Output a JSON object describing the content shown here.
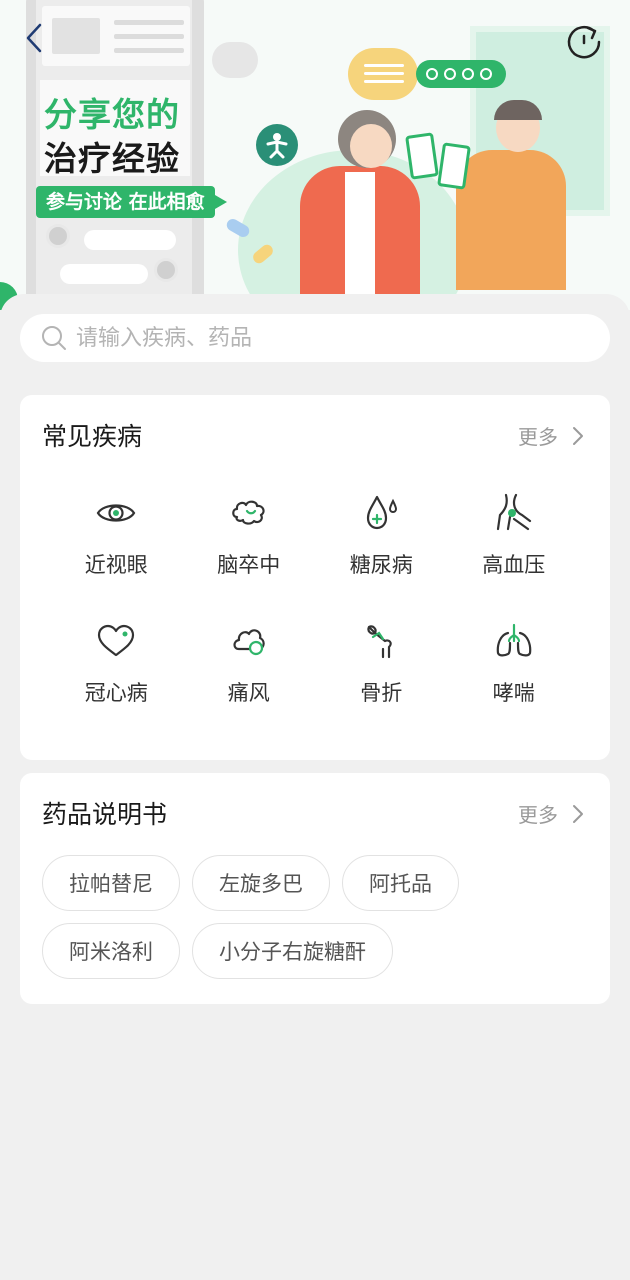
{
  "hero": {
    "title_line1": "分享您的",
    "title_line2": "治疗经验",
    "tagline": "参与讨论 在此相愈"
  },
  "nav": {
    "back_icon": "chevron-left-icon",
    "refresh_icon": "refresh-icon"
  },
  "search": {
    "placeholder": "请输入疾病、药品",
    "value": ""
  },
  "diseases": {
    "title": "常见疾病",
    "more_label": "更多",
    "items": [
      {
        "label": "近视眼",
        "icon": "eye-icon"
      },
      {
        "label": "脑卒中",
        "icon": "brain-icon"
      },
      {
        "label": "糖尿病",
        "icon": "blood-drop-icon"
      },
      {
        "label": "高血压",
        "icon": "blood-vessel-icon"
      },
      {
        "label": "冠心病",
        "icon": "heart-icon"
      },
      {
        "label": "痛风",
        "icon": "gout-icon"
      },
      {
        "label": "骨折",
        "icon": "bone-icon"
      },
      {
        "label": "哮喘",
        "icon": "lungs-icon"
      }
    ]
  },
  "drugs": {
    "title": "药品说明书",
    "more_label": "更多",
    "tags": [
      "拉帕替尼",
      "左旋多巴",
      "阿托品",
      "阿米洛利",
      "小分子右旋糖酐"
    ]
  },
  "colors": {
    "accent": "#2fb56a",
    "icon_stroke": "#333333",
    "background": "#f0f0f0"
  }
}
